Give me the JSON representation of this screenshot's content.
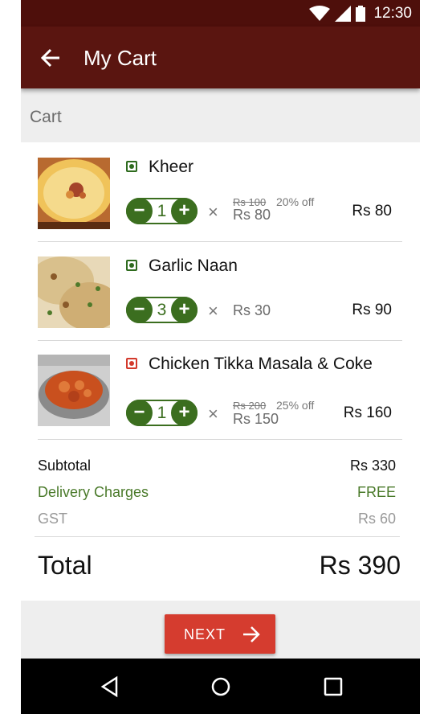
{
  "status": {
    "time": "12:30"
  },
  "appbar": {
    "title": "My Cart"
  },
  "section": {
    "title": "Cart"
  },
  "items": [
    {
      "name": "Kheer",
      "qty": "1",
      "old_price": "Rs 100",
      "discount": "20% off",
      "unit_price": "Rs 80",
      "total": "Rs 80",
      "veg": true
    },
    {
      "name": "Garlic Naan",
      "qty": "3",
      "old_price": "",
      "discount": "",
      "unit_price": "Rs 30",
      "total": "Rs 90",
      "veg": true
    },
    {
      "name": "Chicken Tikka Masala & Coke",
      "qty": "1",
      "old_price": "Rs 200",
      "discount": "25% off",
      "unit_price": "Rs 150",
      "total": "Rs 160",
      "veg": false
    }
  ],
  "summary": {
    "subtotal_label": "Subtotal",
    "subtotal_value": "Rs 330",
    "delivery_label": "Delivery Charges",
    "delivery_value": "FREE",
    "gst_label": "GST",
    "gst_value": "Rs 60",
    "total_label": "Total",
    "total_value": "Rs 390"
  },
  "footer": {
    "next_label": "NEXT"
  },
  "colors": {
    "appbar": "#5a1510",
    "statusbar": "#4e0f0b",
    "accent_green": "#3b6e1f",
    "next_button": "#d53c2f",
    "veg": "#2e6b1e",
    "nonveg": "#d33a2c"
  },
  "icons": {
    "back": "arrow-left-icon",
    "next": "arrow-right-icon",
    "wifi": "wifi-icon",
    "signal": "signal-icon",
    "battery": "battery-icon"
  }
}
